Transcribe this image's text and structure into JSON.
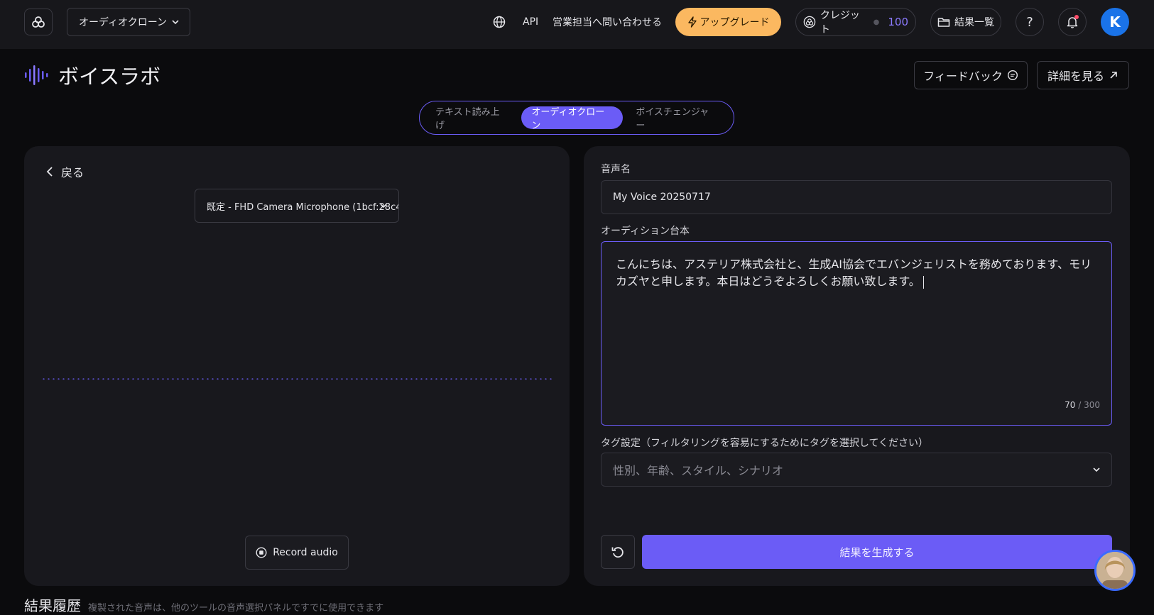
{
  "header": {
    "tool_select": "オーディオクローン",
    "api": "API",
    "contact": "営業担当へ問い合わせる",
    "upgrade": "アップグレード",
    "credit_label": "クレジット",
    "credit_amount": "100",
    "results": "結果一覧",
    "help": "?",
    "avatar_initial": "K"
  },
  "page": {
    "title": "ボイスラボ",
    "feedback": "フィードバック",
    "details": "詳細を見る"
  },
  "tabs": [
    {
      "label": "テキスト読み上げ",
      "active": false
    },
    {
      "label": "オーディオクローン",
      "active": true
    },
    {
      "label": "ボイスチェンジャー",
      "active": false
    }
  ],
  "left": {
    "back": "戻る",
    "mic": "既定 - FHD Camera Microphone (1bcf:28c4",
    "record": "Record audio"
  },
  "right": {
    "name_label": "音声名",
    "name_value": "My Voice 20250717",
    "script_label": "オーディション台本",
    "script_text": "こんにちは、アステリア株式会社と、生成AI協会でエバンジェリストを務めております、モリカズヤと申します。本日はどうぞよろしくお願い致します。",
    "count_current": "70",
    "count_max": " / 300",
    "tags_label": "タグ設定（フィルタリングを容易にするためにタグを選択してください）",
    "tags_placeholder": "性別、年齢、スタイル、シナリオ",
    "generate": "結果を生成する"
  },
  "history": {
    "title": "結果履歴",
    "subtitle": "複製された音声は、他のツールの音声選択パネルですでに使用できます"
  },
  "colors": {
    "accent": "#6b5cf6",
    "upgrade": "#fbb860",
    "avatar": "#1a73e8"
  }
}
